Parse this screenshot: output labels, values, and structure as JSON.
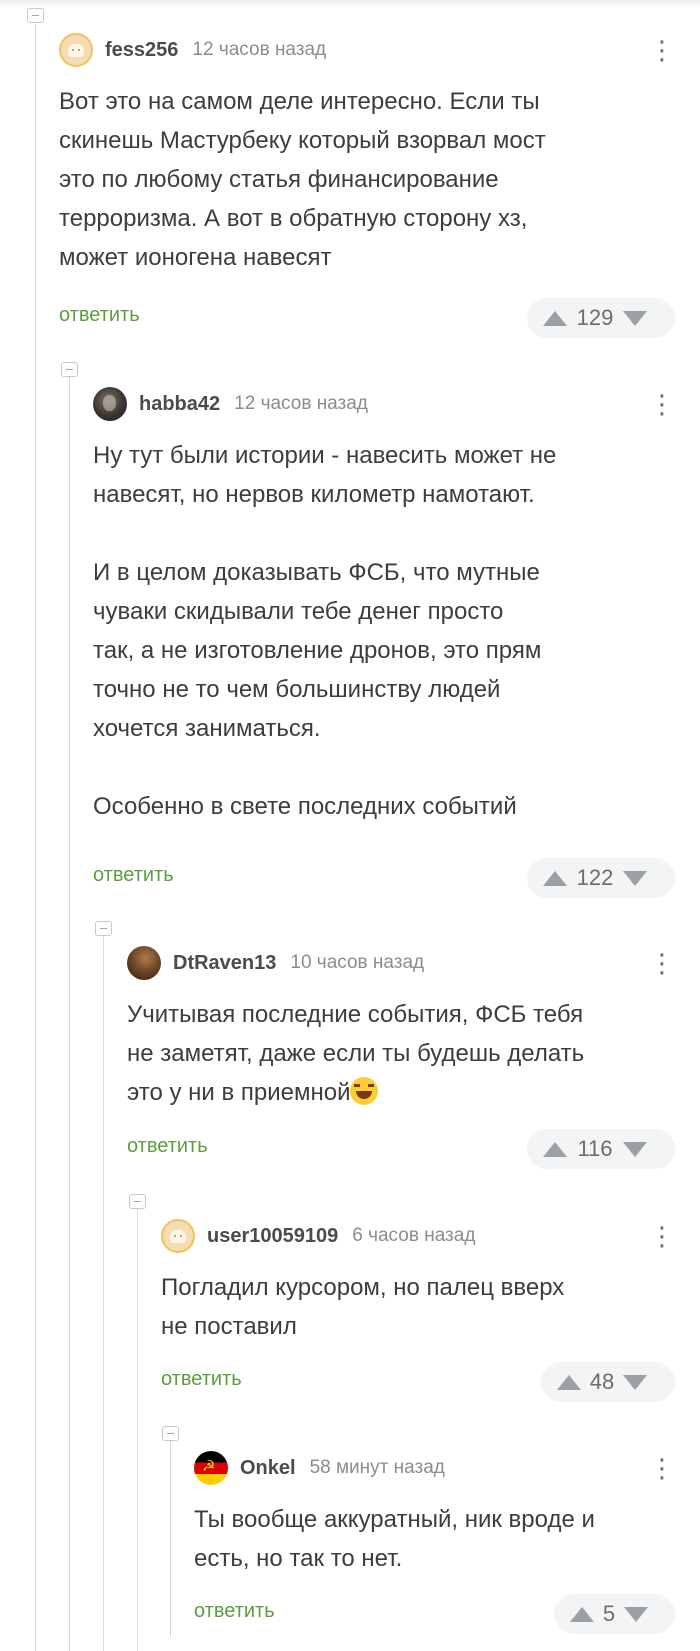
{
  "comments": [
    {
      "username": "fess256",
      "time": "12 часов назад",
      "avatar_icon": "avatar-beige-icon",
      "text": "Вот это на самом деле интересно. Если ты\nскинешь Мастурбеку который взорвал мост\nэто по любому статья финансирование\nтерроризма. А вот в обратную сторону хз,\nможет ионогена навесят",
      "reply_label": "ответить",
      "score": "129"
    },
    {
      "username": "habba42",
      "time": "12 часов назад",
      "avatar_icon": "avatar-dark-icon",
      "text": "Ну тут были истории - навесить может не\nнавесят, но нервов километр намотают.\n\nИ в целом доказывать ФСБ, что мутные\nчуваки скидывали тебе денег просто\nтак, а не изготовление дронов, это прям\nточно не то чем большинству людей\nхочется заниматься.\n\nОсобенно в свете последних событий",
      "reply_label": "ответить",
      "score": "122"
    },
    {
      "username": "DtRaven13",
      "time": "10 часов назад",
      "avatar_icon": "avatar-brown-icon",
      "text": "Учитывая последние события, ФСБ тебя\nне заметят, даже если ты будешь делать\nэто у ни в приемной",
      "emoji": "rolling-laughing-emoji",
      "reply_label": "ответить",
      "score": "116"
    },
    {
      "username": "user10059109",
      "time": "6 часов назад",
      "avatar_icon": "avatar-beige-icon",
      "text": "Погладил курсором, но палец вверх\nне поставил",
      "reply_label": "ответить",
      "score": "48"
    },
    {
      "username": "Onkel",
      "time": "58 минут назад",
      "avatar_icon": "avatar-flag-icon",
      "text": "Ты вообще аккуратный, ник вроде и\nесть, но так то нет.",
      "reply_label": "ответить",
      "score": "5"
    }
  ],
  "colors": {
    "reply": "#5a9f3c",
    "rating_bg": "#f2f4f5",
    "vote_arrow": "#9aa0a4"
  },
  "more_icon": "⋮"
}
